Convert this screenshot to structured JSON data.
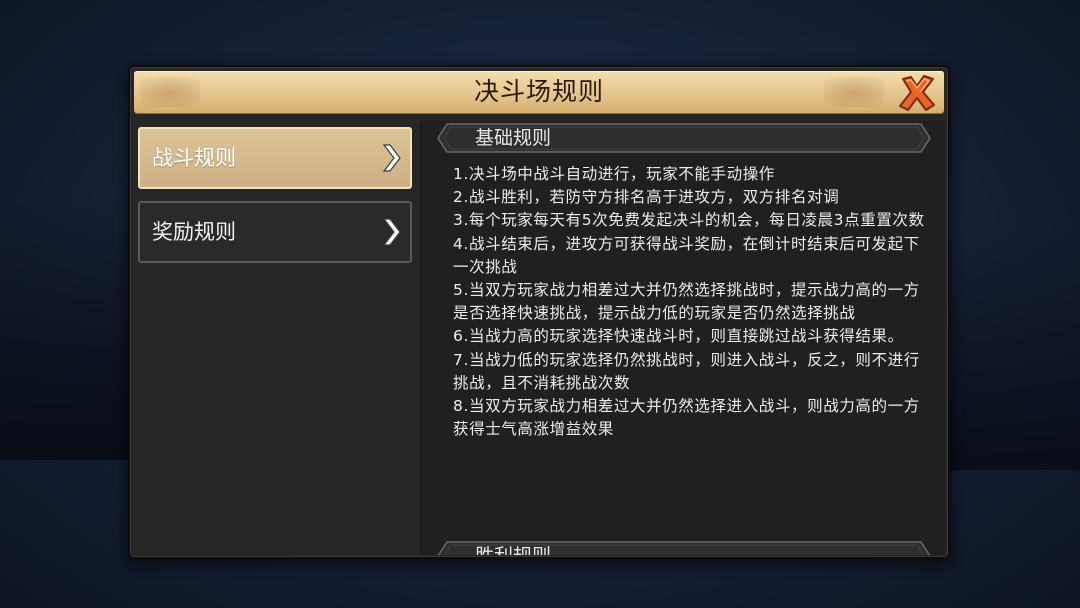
{
  "dialog": {
    "title": "决斗场规则"
  },
  "sidebar": {
    "items": [
      {
        "label": "战斗规则",
        "active": true
      },
      {
        "label": "奖励规则",
        "active": false
      }
    ]
  },
  "content": {
    "sections": [
      {
        "title": "基础规则",
        "rules": [
          "1.决斗场中战斗自动进行，玩家不能手动操作",
          "2.战斗胜利，若防守方排名高于进攻方，双方排名对调",
          "3.每个玩家每天有5次免费发起决斗的机会，每日凌晨3点重置次数",
          "4.战斗结束后，进攻方可获得战斗奖励，在倒计时结束后可发起下一次挑战",
          "5.当双方玩家战力相差过大并仍然选择挑战时，提示战力高的一方是否选择快速挑战，提示战力低的玩家是否仍然选择挑战",
          "6.当战力高的玩家选择快速战斗时，则直接跳过战斗获得结果。",
          "7.当战力低的玩家选择仍然挑战时，则进入战斗，反之，则不进行挑战，且不消耗挑战次数",
          "8.当双方玩家战力相差过大并仍然选择进入战斗，则战力高的一方获得士气高涨增益效果"
        ]
      },
      {
        "title": "胜利规则"
      }
    ]
  },
  "icons": {
    "close": "close-x-icon",
    "chevron": "chevron-right-icon"
  },
  "colors": {
    "title_bar": "#e6c68e",
    "close_icon": "#e8642a",
    "active_tab": "#d5bb90",
    "panel_bg": "#262626"
  }
}
